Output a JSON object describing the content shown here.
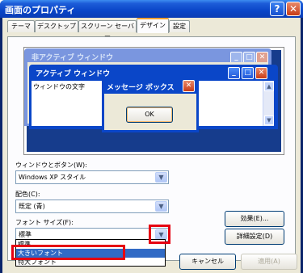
{
  "window": {
    "title": "画面のプロパティ",
    "help_label": "?",
    "close_label": "✕"
  },
  "tabs": [
    {
      "label": "テーマ"
    },
    {
      "label": "デスクトップ"
    },
    {
      "label": "スクリーン セーバー"
    },
    {
      "label": "デザイン",
      "selected": true
    },
    {
      "label": "設定"
    }
  ],
  "preview": {
    "inactive_title": "非アクティブ ウィンドウ",
    "active_title": "アクティブ ウィンドウ",
    "window_text": "ウィンドウの文字",
    "message_title": "メッセージ ボックス",
    "ok_label": "OK",
    "min_glyph": "_",
    "max_glyph": "□",
    "close_glyph": "✕",
    "scroll_up": "▲",
    "scroll_down": "▼"
  },
  "fields": {
    "windows_buttons_label": "ウィンドウとボタン(W):",
    "windows_buttons_value": "Windows XP スタイル",
    "color_label": "配色(C):",
    "color_value": "既定 (青)",
    "font_size_label": "フォント サイズ(F):",
    "font_size_value": "標準",
    "arrow": "▼"
  },
  "dropdown": {
    "options": [
      "標準",
      "大きいフォント",
      "特大フォント"
    ],
    "highlighted": "大きいフォント"
  },
  "buttons": {
    "effects": "効果(E)...",
    "advanced": "詳細設定(D)",
    "cancel": "キャンセル",
    "apply": "適用(A)"
  },
  "colors": {
    "selection": "#316AC5",
    "highlight_box": "#E60012",
    "titlebar": "#0A46C8",
    "desktop": "#163C8C"
  }
}
